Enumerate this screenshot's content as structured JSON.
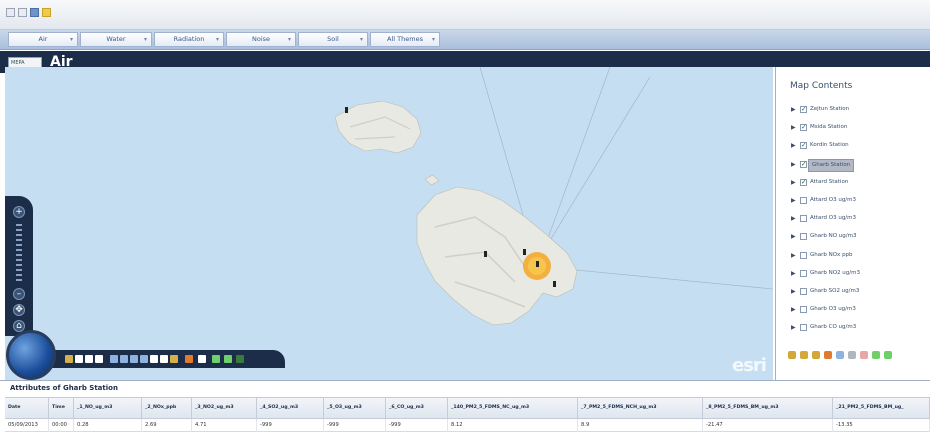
{
  "tabs": [
    {
      "label": "Air"
    },
    {
      "label": "Water"
    },
    {
      "label": "Radiation"
    },
    {
      "label": "Noise"
    },
    {
      "label": "Soil"
    },
    {
      "label": "All Themes"
    }
  ],
  "header": {
    "title": "Air",
    "logo_text": "MEPA"
  },
  "map": {
    "attribution": "esri",
    "selected_station": "Gharb Station"
  },
  "map_contents": {
    "title": "Map Contents",
    "layers": [
      {
        "label": "Zejtun Station",
        "checked": true
      },
      {
        "label": "Msida Station",
        "checked": true
      },
      {
        "label": "Kordin Station",
        "checked": true
      },
      {
        "label": "Gharb Station",
        "checked": true,
        "selected": true
      },
      {
        "label": "Attard Station",
        "checked": true
      },
      {
        "label": "Attard O3 ug/m3",
        "checked": false
      },
      {
        "label": "Attard O3 ug/m3",
        "checked": false
      },
      {
        "label": "Gharb NO ug/m3",
        "checked": false
      },
      {
        "label": "Gharb NOx ppb",
        "checked": false
      },
      {
        "label": "Gharb NO2 ug/m3",
        "checked": false
      },
      {
        "label": "Gharb SO2 ug/m3",
        "checked": false
      },
      {
        "label": "Gharb O3 ug/m3",
        "checked": false
      },
      {
        "label": "Gharb CO ug/m3",
        "checked": false
      }
    ]
  },
  "attributes": {
    "title": "Attributes of Gharb Station",
    "columns": [
      "Date",
      "Time",
      "_1_NO_ug_m3",
      "_2_NOx_ppb",
      "_3_NO2_ug_m3",
      "_4_SO2_ug_m3",
      "_5_O3_ug_m3",
      "_6_CO_ug_m3",
      "_140_PM2_5_FDMS_NC_ug_m3",
      "_7_PM2_5_FDMS_NCH_ug_m3",
      "_8_PM2_5_FDMS_BM_ug_m3",
      "_21_PM2_5_FDMS_BM_ug_"
    ],
    "rows": [
      [
        "05/09/2013",
        "00:00",
        "0.28",
        "2.69",
        "4.71",
        "-999",
        "-999",
        "-999",
        "8.12",
        "8.9",
        "-21.47",
        "-13.35"
      ]
    ]
  },
  "colors": {
    "dark_navy": "#1b2d48",
    "sea": "#c6def1",
    "land": "#e9e9e3",
    "highlight": "#f5a623"
  }
}
